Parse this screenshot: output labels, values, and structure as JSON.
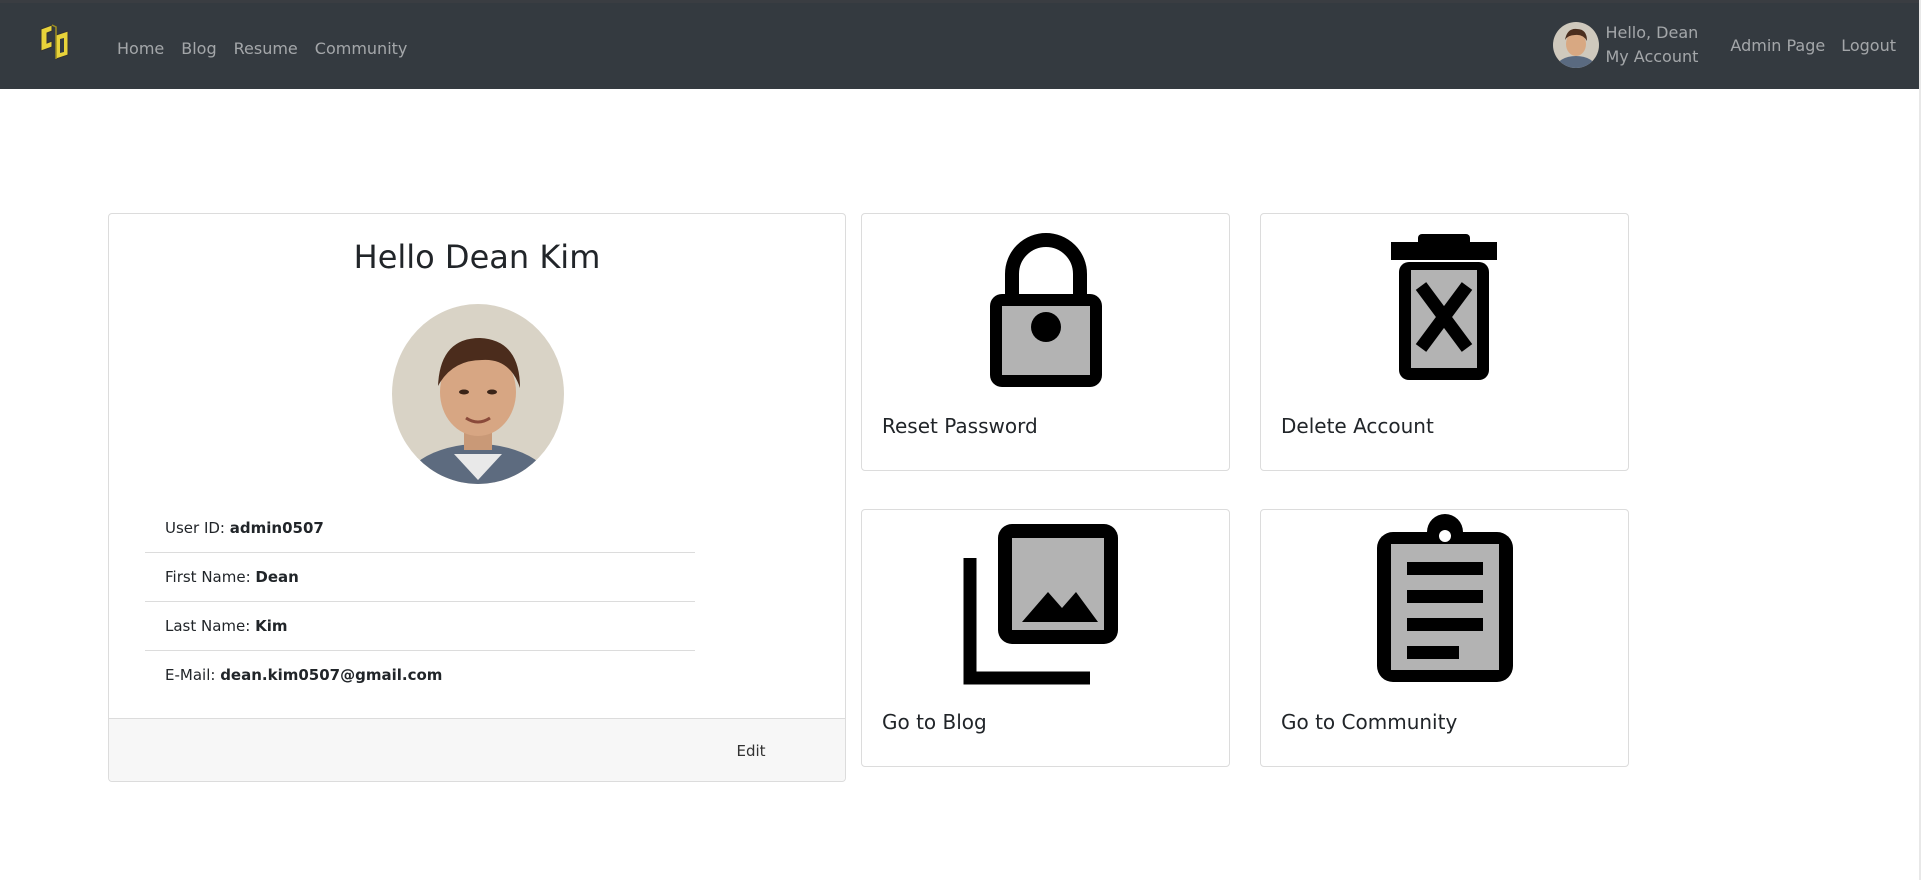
{
  "nav": {
    "links": [
      "Home",
      "Blog",
      "Resume",
      "Community"
    ],
    "greeting": "Hello, Dean",
    "account": "My Account",
    "admin": "Admin Page",
    "logout": "Logout"
  },
  "profile": {
    "title": "Hello Dean Kim",
    "fields": [
      {
        "label": "User ID: ",
        "value": "admin0507"
      },
      {
        "label": "First Name: ",
        "value": "Dean"
      },
      {
        "label": "Last Name: ",
        "value": "Kim"
      },
      {
        "label": "E-Mail: ",
        "value": "dean.kim0507@gmail.com"
      }
    ],
    "edit_label": "Edit"
  },
  "tiles": [
    {
      "label": "Reset Password",
      "icon": "lock-icon"
    },
    {
      "label": "Delete Account",
      "icon": "trash-icon"
    },
    {
      "label": "Go to Blog",
      "icon": "photo-library-icon"
    },
    {
      "label": "Go to Community",
      "icon": "clipboard-icon"
    }
  ],
  "colors": {
    "navbar": "#343a40",
    "logo": "#e8d33a",
    "icon_fill": "#b3b3b3"
  }
}
